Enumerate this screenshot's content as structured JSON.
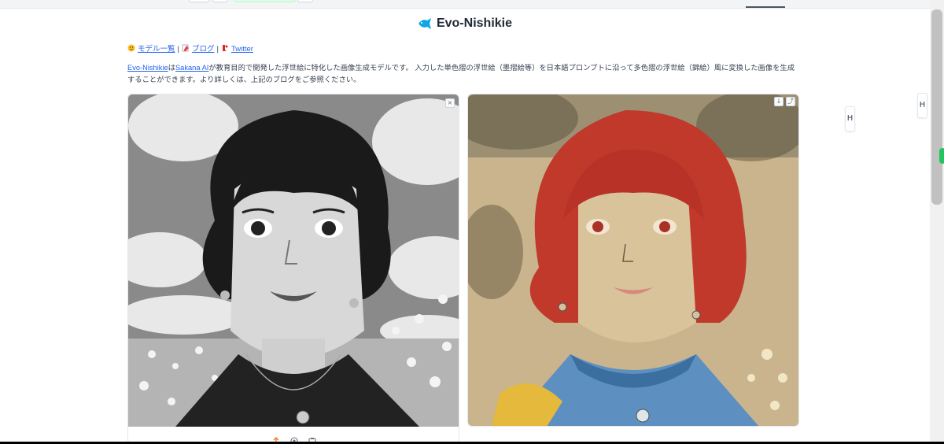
{
  "app": {
    "title": "Evo-Nishikie"
  },
  "links": [
    {
      "label": "モデル一覧",
      "icon": "hugging-face-icon"
    },
    {
      "label": "ブログ",
      "icon": "memo-icon"
    },
    {
      "label": "Twitter",
      "icon": "fish-icon"
    }
  ],
  "link_separator": "|",
  "description": {
    "link1": "Evo-Nishikie",
    "text1": "は",
    "link2": "Sakana AI",
    "text2": "が教育目的で開発した浮世絵に特化した画像生成モデルです。 入力した単色摺の浮世絵（墨摺絵等）を日本語プロンプトに沿って多色摺の浮世絵（錦絵）風に変換した画像を生成することができます。より詳しくは、上記のブログをご参照ください。"
  },
  "input_panel": {
    "clear_icon": "×",
    "toolbar_icons": [
      "upload-icon",
      "webcam-icon",
      "clipboard-icon"
    ]
  },
  "output_panel": {
    "download_icon": "download-icon",
    "share_icon": "share-icon"
  },
  "side_handles": [
    "H",
    "H"
  ],
  "colors": {
    "link": "#2563eb",
    "accent_fish": "#0ea5e9",
    "scroll_indicator": "#22c55e"
  }
}
